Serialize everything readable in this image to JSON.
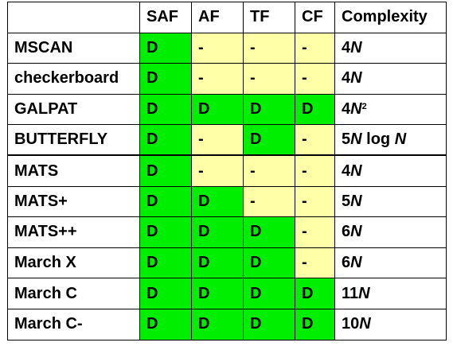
{
  "header": [
    "",
    "SAF",
    "AF",
    "TF",
    "CF",
    "Complexity"
  ],
  "colors": {
    "detected": "#00ee00",
    "not_detected": "#ffffa8"
  },
  "rows": [
    {
      "name": "MSCAN",
      "cells": [
        "D",
        "-",
        "-",
        "-"
      ],
      "complexity": {
        "coef": "4",
        "var": "N",
        "sup": "",
        "suffix": ""
      }
    },
    {
      "name": "checkerboard",
      "cells": [
        "D",
        "-",
        "-",
        "-"
      ],
      "complexity": {
        "coef": "4",
        "var": "N",
        "sup": "",
        "suffix": ""
      }
    },
    {
      "name": "GALPAT",
      "cells": [
        "D",
        "D",
        "D",
        "D"
      ],
      "complexity": {
        "coef": "4",
        "var": "N",
        "sup": "2",
        "suffix": ""
      }
    },
    {
      "name": "BUTTERFLY",
      "cells": [
        "D",
        "-",
        "D",
        "-"
      ],
      "complexity": {
        "coef": "5",
        "var": "N",
        "sup": "",
        "suffix": " log ",
        "var2": "N"
      }
    },
    {
      "name": "MATS",
      "cells": [
        "D",
        "-",
        "-",
        "-"
      ],
      "complexity": {
        "coef": "4",
        "var": "N",
        "sup": "",
        "suffix": ""
      }
    },
    {
      "name": "MATS+",
      "cells": [
        "D",
        "D",
        "-",
        "-"
      ],
      "complexity": {
        "coef": "5",
        "var": "N",
        "sup": "",
        "suffix": ""
      }
    },
    {
      "name": "MATS++",
      "cells": [
        "D",
        "D",
        "D",
        "-"
      ],
      "complexity": {
        "coef": "6",
        "var": "N",
        "sup": "",
        "suffix": ""
      }
    },
    {
      "name": "March X",
      "cells": [
        "D",
        "D",
        "D",
        "-"
      ],
      "complexity": {
        "coef": "6",
        "var": "N",
        "sup": "",
        "suffix": ""
      }
    },
    {
      "name": "March C",
      "cells": [
        "D",
        "D",
        "D",
        "D"
      ],
      "complexity": {
        "coef": "11",
        "var": "N",
        "sup": "",
        "suffix": ""
      }
    },
    {
      "name": "March C-",
      "cells": [
        "D",
        "D",
        "D",
        "D"
      ],
      "complexity": {
        "coef": "10",
        "var": "N",
        "sup": "",
        "suffix": ""
      }
    }
  ]
}
